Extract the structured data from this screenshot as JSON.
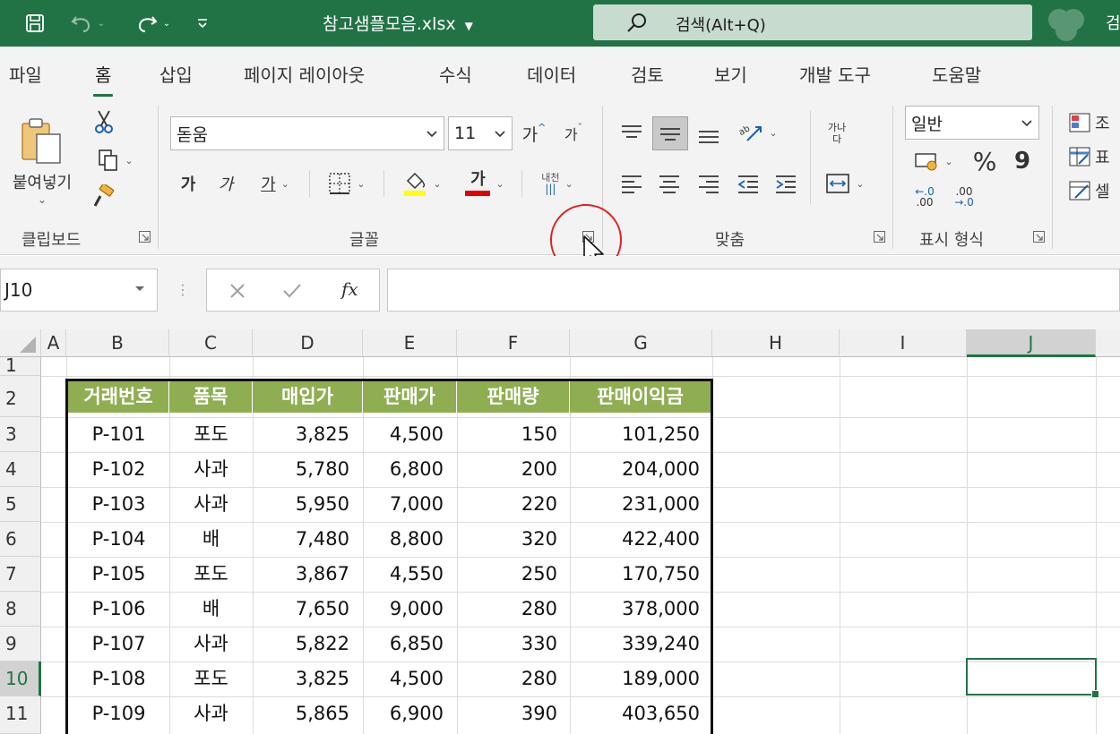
{
  "titlebar": {
    "file_title": "참고샘플모음.xlsx",
    "search_text": "검색(Alt+Q)",
    "account_initial": "검",
    "accent_color": "#217346"
  },
  "tabs": [
    "파일",
    "홈",
    "삽입",
    "페이지 레이아웃",
    "수식",
    "데이터",
    "검토",
    "보기",
    "개발 도구",
    "도움말"
  ],
  "active_tab": "홈",
  "ribbon": {
    "clipboard": {
      "paste_label": "붙여넣기",
      "group_label": "클립보드"
    },
    "font": {
      "font_name": "돋움",
      "font_size": "11",
      "grow_label": "가",
      "shrink_label": "가",
      "bold_label": "가",
      "italic_label": "가",
      "underline_label": "가",
      "font_color_label": "가",
      "phonetic_top": "내천",
      "group_label": "글꼴",
      "fill_color": "#ffff00",
      "font_color": "#e00000"
    },
    "alignment": {
      "wrap_label_top": "가나",
      "wrap_label_bottom": "다",
      "group_label": "맞춤"
    },
    "number": {
      "format": "일반",
      "percent": "%",
      "comma": "9",
      "dec_inc_top": ".0",
      "dec_inc_bottom": ".00",
      "dec_dec_top": ".00",
      "dec_dec_bottom": "→.0",
      "group_label": "표시 형식"
    },
    "styles": {
      "cond_label": "조",
      "table_label": "표",
      "cell_label": "셀"
    }
  },
  "formula_bar": {
    "name_box": "J10",
    "fx_label": "fx",
    "formula": ""
  },
  "columns": [
    "A",
    "B",
    "C",
    "D",
    "E",
    "F",
    "G",
    "H",
    "I",
    "J"
  ],
  "selected_column": "J",
  "rows": [
    "1",
    "2",
    "3",
    "4",
    "5",
    "6",
    "7",
    "8",
    "9",
    "10",
    "11"
  ],
  "selected_row": "10",
  "table": {
    "headers": [
      "거래번호",
      "품목",
      "매입가",
      "판매가",
      "판매량",
      "판매이익금"
    ],
    "header_color": "#8fae52",
    "rows": [
      [
        "P-101",
        "포도",
        "3,825",
        "4,500",
        "150",
        "101,250"
      ],
      [
        "P-102",
        "사과",
        "5,780",
        "6,800",
        "200",
        "204,000"
      ],
      [
        "P-103",
        "사과",
        "5,950",
        "7,000",
        "220",
        "231,000"
      ],
      [
        "P-104",
        "배",
        "7,480",
        "8,800",
        "320",
        "422,400"
      ],
      [
        "P-105",
        "포도",
        "3,867",
        "4,550",
        "250",
        "170,750"
      ],
      [
        "P-106",
        "배",
        "7,650",
        "9,000",
        "280",
        "378,000"
      ],
      [
        "P-107",
        "사과",
        "5,822",
        "6,850",
        "330",
        "339,240"
      ],
      [
        "P-108",
        "포도",
        "3,825",
        "4,500",
        "280",
        "189,000"
      ],
      [
        "P-109",
        "사과",
        "5,865",
        "6,900",
        "390",
        "403,650"
      ]
    ]
  }
}
